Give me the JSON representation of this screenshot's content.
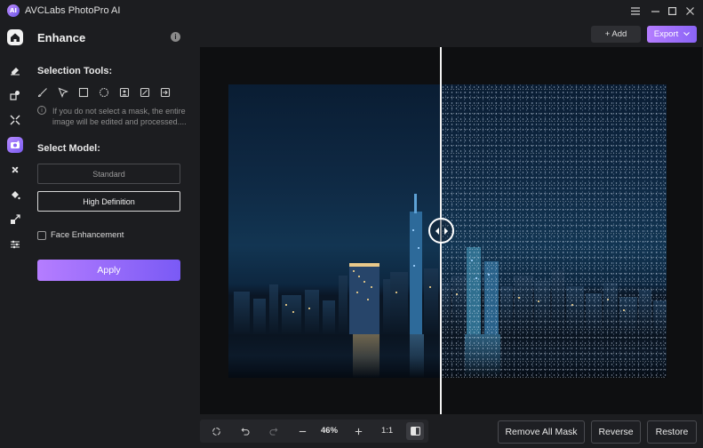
{
  "app": {
    "title": "AVCLabs PhotoPro AI",
    "logo_text": "AI",
    "window_controls": [
      "menu-icon",
      "minimize-icon",
      "maximize-icon",
      "close-icon"
    ]
  },
  "rail": {
    "items": [
      "home-icon",
      "eraser-icon",
      "replace-icon",
      "crop-icon",
      "enhance-icon",
      "fan-icon",
      "fill-icon",
      "expand-icon",
      "sliders-icon"
    ],
    "active": "enhance-icon"
  },
  "panel": {
    "title": "Enhance",
    "selection_tools_label": "Selection Tools:",
    "tools": [
      "brush-icon",
      "lasso-icon",
      "rectangle-icon",
      "ellipse-icon",
      "portrait-icon",
      "auto-select-icon",
      "import-mask-icon"
    ],
    "hint": "If you do not select a mask, the entire image will be edited and processed....",
    "select_model_label": "Select Model:",
    "models": [
      "Standard",
      "High Definition"
    ],
    "selected_model": "High Definition",
    "face_enhancement_label": "Face Enhancement",
    "face_enhancement_checked": false,
    "apply_label": "Apply"
  },
  "toolbar": {
    "add_label": "+ Add",
    "export_label": "Export"
  },
  "viewer": {
    "compare_split_fraction": 0.485
  },
  "bottom": {
    "zoom": "46%",
    "ratio_label": "1:1",
    "remove_all_mask_label": "Remove All Mask",
    "reverse_label": "Reverse",
    "restore_label": "Restore"
  },
  "colors": {
    "accent_start": "#b57dff",
    "accent_end": "#7a5af5",
    "background": "#1c1d20"
  }
}
